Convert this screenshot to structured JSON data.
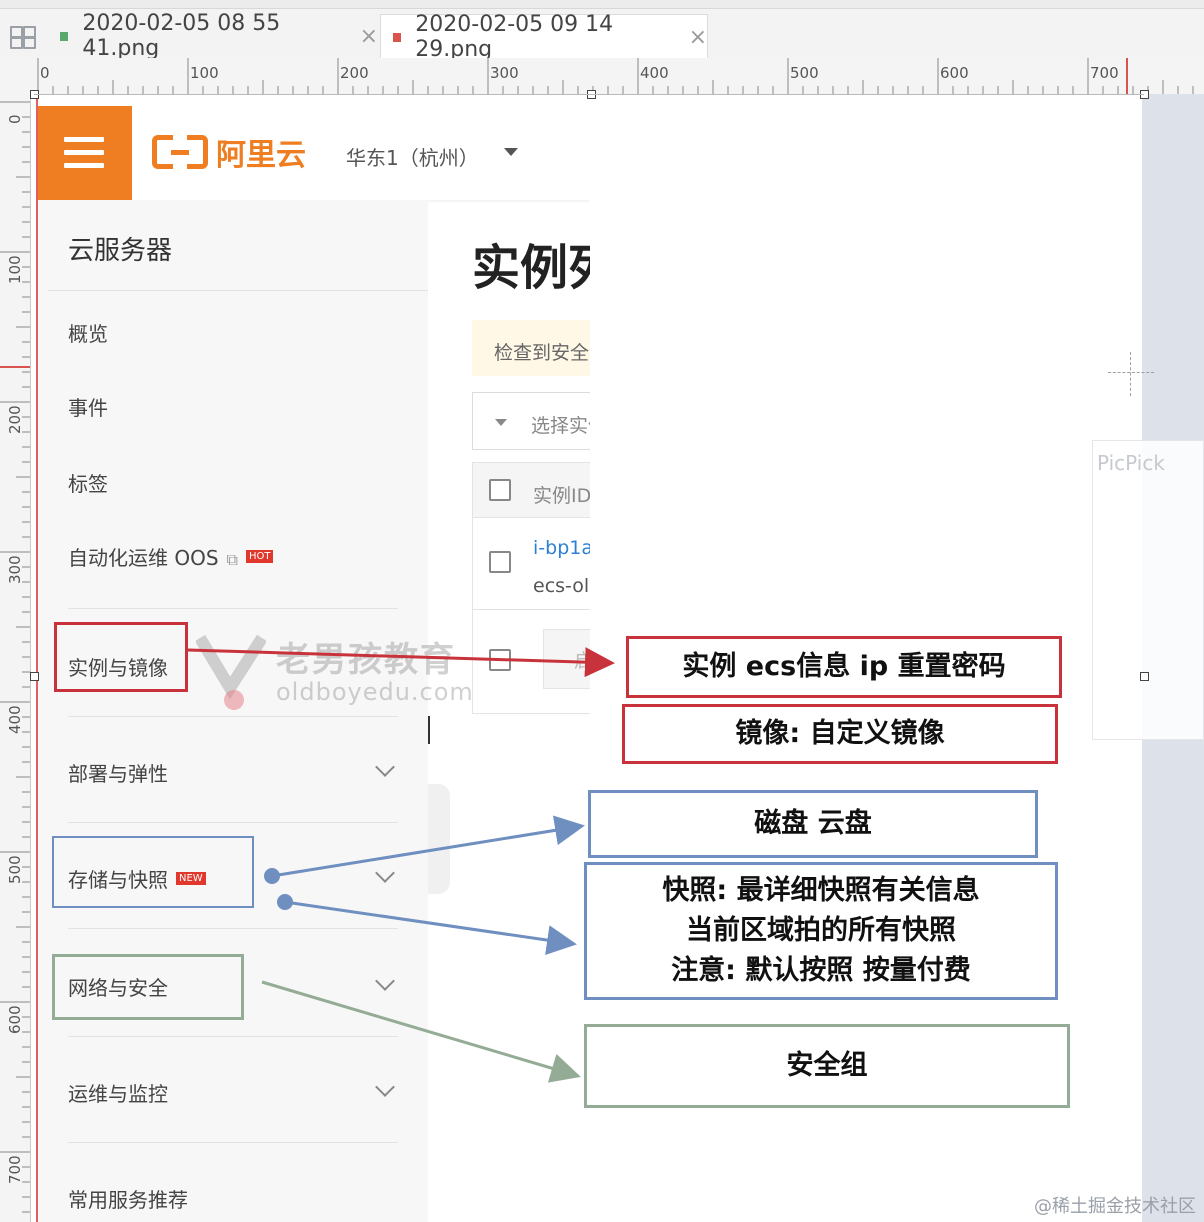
{
  "editor": {
    "tabs": [
      {
        "label": "2020-02-05 08 55 41.png",
        "color": "#5aa86e",
        "active": false
      },
      {
        "label": "2020-02-05 09 14 29.png",
        "color": "#d9534f",
        "active": true
      }
    ],
    "close_glyph": "×",
    "ruler_h": [
      "0",
      "100",
      "200",
      "300",
      "400",
      "500",
      "600",
      "700"
    ],
    "ruler_v": [
      "0",
      "100",
      "200",
      "300",
      "400",
      "500",
      "600",
      "700"
    ],
    "picpick_label": "PicPick"
  },
  "console": {
    "logo_text": "阿里云",
    "region": "华东1（杭州）",
    "sidebar_title": "云服务器",
    "menu": [
      {
        "label": "概览"
      },
      {
        "label": "事件"
      },
      {
        "label": "标签"
      },
      {
        "label": "自动化运维 OOS",
        "badge": "HOT"
      },
      {
        "label": "实例与镜像"
      },
      {
        "label": "部署与弹性"
      },
      {
        "label": "存储与快照",
        "badge": "NEW"
      },
      {
        "label": "网络与安全"
      },
      {
        "label": "运维与监控"
      },
      {
        "label": "常用服务推荐"
      }
    ],
    "main_title": "实例列表",
    "notice": "检查到安全组",
    "filter_placeholder": "选择实例属性",
    "table_header": "实例ID",
    "row_id": "i-bp1a",
    "row_name": "ecs-ol",
    "pager_glyph": "启"
  },
  "annotations": {
    "box_instance": "实例 ecs信息  ip  重置密码",
    "box_image": "镜像: 自定义镜像",
    "box_disk": "磁盘    云盘",
    "box_snapshot": [
      "快照:  最详细快照有关信息",
      "当前区域拍的所有快照",
      "注意: 默认按照 按量付费"
    ],
    "box_security": "安全组",
    "colors": {
      "red": "#c8333b",
      "blue": "#6f8fc0",
      "green": "#94ac96"
    }
  },
  "watermark": {
    "cn": "老男孩教育",
    "en": "oldboyedu.com",
    "footer": "@稀土掘金技术社区"
  }
}
